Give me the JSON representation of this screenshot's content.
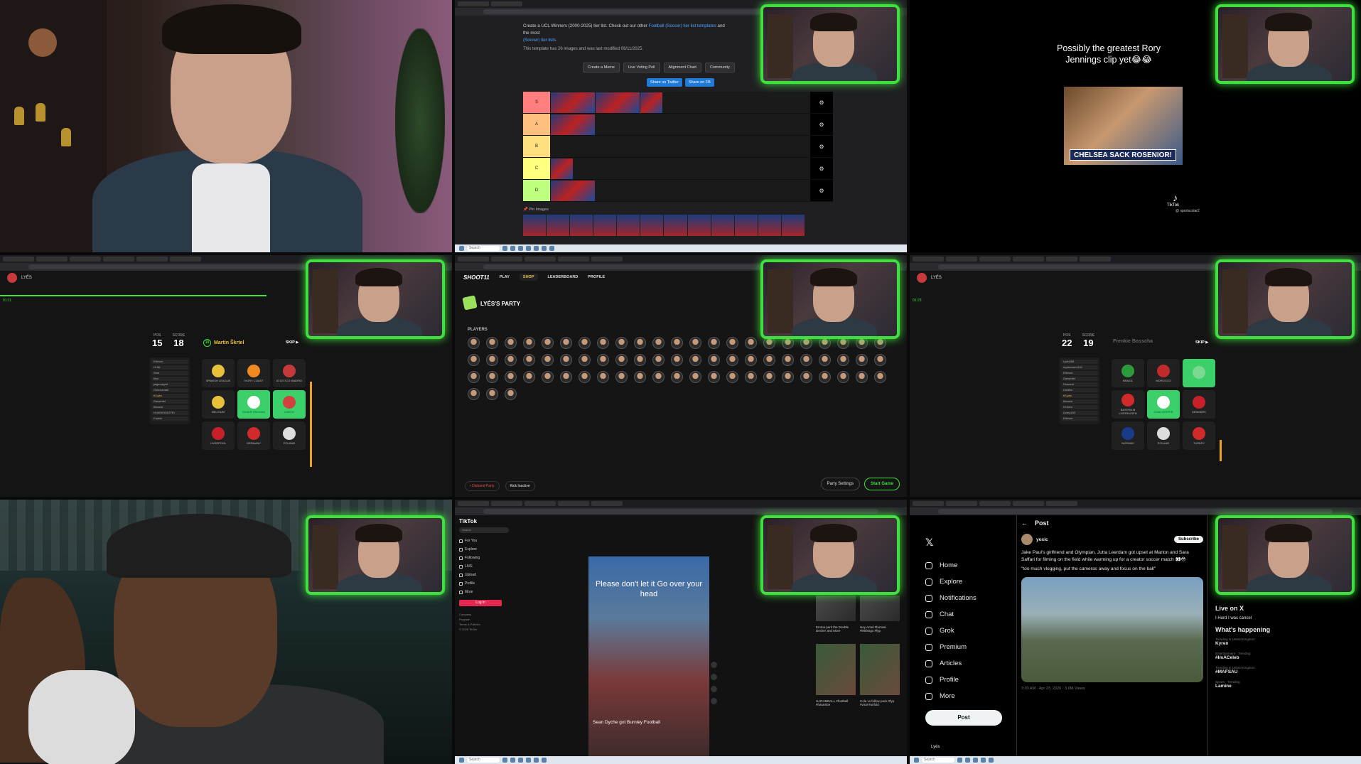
{
  "tier_list": {
    "intro_prefix": "Create a UCL Winners (2000-2025) tier list. Check out our other ",
    "intro_link": "Football (Soccer) tier list templates",
    "intro_suffix": " and the most",
    "intro_link2": "(Soccer) tier lists.",
    "meta": "This template has 26 images and was last modified 06/11/2025.",
    "buttons": [
      "Create a Meme",
      "Live Voting Poll",
      "Alignment Chart",
      "Community"
    ],
    "share": [
      "Share on Twitter",
      "Share on FB"
    ],
    "tiers": [
      {
        "label": "S",
        "color": "#ff7f7f"
      },
      {
        "label": "A",
        "color": "#ffbf7f"
      },
      {
        "label": "B",
        "color": "#ffdf7f"
      },
      {
        "label": "C",
        "color": "#ffff7f"
      },
      {
        "label": "D",
        "color": "#bfff7f"
      }
    ],
    "pin_label": "Pin Images"
  },
  "tiktok_clip": {
    "caption": "Possibly the greatest Rory Jennings clip yet😂😂",
    "banner": "CHELSEA SACK ROSENIOR!",
    "brand": "TikTok",
    "user": "@ sportscolar2"
  },
  "game_left": {
    "user": "LYÉS",
    "timer": "01:11",
    "pos_label": "POS",
    "pos_value": "15",
    "score_label": "SCORE",
    "score_value": "18",
    "player_number": "10",
    "player_name": "Martin Škrtel",
    "skip": "SKIP ▶",
    "board": [
      "Etienne",
      "Hi Mt",
      "Sme",
      "Ben",
      "jaigerragmt",
      "Ooreruinate",
      "K'Lyés",
      "Dansedel",
      "Bsmuw",
      "Hi AMICKNOTEI",
      "Fudolo"
    ],
    "board_me_index": 6,
    "cards": [
      {
        "label": "SPANISH LEAGUE",
        "flag": "#e8c13a",
        "green": false
      },
      {
        "label": "IVORY COAST",
        "flag": "#f08a20",
        "green": false
      },
      {
        "label": "ATLETICO MADRID",
        "flag": "#c23a3a",
        "green": false
      },
      {
        "label": "BELGIUM",
        "flag": "#e8c13a",
        "green": false
      },
      {
        "label": "DIDIER DROGBA",
        "flag": "#ffffff",
        "green": true
      },
      {
        "label": "CZECH",
        "flag": "#d04040",
        "green": true
      },
      {
        "label": "LIVERPOOL",
        "flag": "#c8202a",
        "green": false
      },
      {
        "label": "GERMANY",
        "flag": "#d02a2a",
        "green": false
      },
      {
        "label": "POLAND",
        "flag": "#dddddd",
        "green": false
      }
    ]
  },
  "party": {
    "logo": "SHOOT11",
    "nav": [
      "PLAY",
      "SHOP",
      "LEADERBOARD",
      "PROFILE"
    ],
    "active_index": 1,
    "title": "LYÉS'S PARTY",
    "players_label": "PLAYERS",
    "player_count": 72,
    "disband": "• Disband Party",
    "kick": "Kick Inactive",
    "settings": "Party Settings",
    "start": "Start Game"
  },
  "game_right": {
    "user": "LYÉS",
    "timer": "01:23",
    "pos_label": "POS",
    "pos_value": "22",
    "score_label": "SCORE",
    "score_value": "19",
    "player_name": "Frenkie Bosscha",
    "skip": "SKIP ▶",
    "board": [
      "Lyeh888",
      "mysteman1101",
      "Etienne",
      "Dansedel",
      "Dsmand",
      "Ltshitla",
      "K'Lyés",
      "Bsmuw",
      "Hi Aero",
      "Dzmy100",
      "Etienne"
    ],
    "board_me_index": 6,
    "cards": [
      {
        "label": "BRAZIL",
        "flag": "#2a9a3a",
        "green": false
      },
      {
        "label": "MOROCCO",
        "flag": "#c02a2a",
        "green": false
      },
      {
        "label": "",
        "flag": "#7ad890",
        "green": true
      },
      {
        "label": "BAYERN M LIVERKUSEN",
        "flag": "#d02a2a",
        "green": false
      },
      {
        "label": "GOALKEEPER",
        "flag": "#ffffff",
        "green": true
      },
      {
        "label": "DENMARK",
        "flag": "#c8202a",
        "green": false
      },
      {
        "label": "NORWAY",
        "flag": "#1a3a8a",
        "green": false
      },
      {
        "label": "POLAND",
        "flag": "#dddddd",
        "green": false
      },
      {
        "label": "TURKEY",
        "flag": "#d02a2a",
        "green": false
      }
    ]
  },
  "tiktok_web": {
    "logo": "TikTok",
    "search": "Search",
    "nav": [
      "For You",
      "Explore",
      "Following",
      "LIVE",
      "Upload",
      "Profile",
      "More"
    ],
    "login": "Log in",
    "footer": [
      "Company",
      "Program",
      "Terms & Policies",
      "© 2025 TikTok"
    ],
    "caption": "Please don't let it Go over your head",
    "desc": "Sean Dyche got Burnley Football",
    "thumbs": [
      "Emma park the Double Decker and More",
      "Hey Arnel #bonsai #letthisgo #fyp",
      "HARAMBALL #football #harambe",
      "Cole vs follow pack #fyp #viral #unfold"
    ]
  },
  "x": {
    "nav": [
      "Home",
      "Explore",
      "Notifications",
      "Chat",
      "Grok",
      "Premium",
      "Articles",
      "Profile",
      "More"
    ],
    "post_button": "Post",
    "footer_user": "Lyés",
    "header": "Post",
    "author": "yoxic",
    "subscribe": "Subscribe",
    "text": "Jake Paul's girlfriend and Olympian, Jutta Leerdam got upset at Marlon and Sara Saffari for filming on the field while warming up for a creator soccer match 👀😳",
    "quote": "\"too much vlogging, put the cameras away and focus on the ball\"",
    "views": "3:03 AM · Apr 23, 2026 · 3.6M Views",
    "live_title": "Live on X",
    "live_item": "I Hurd I was cancel",
    "happening": "What's happening",
    "trends": [
      {
        "c": "Trending in United Kingdom",
        "t": "Kyren"
      },
      {
        "c": "Entertainment · Trending",
        "t": "#ImACeleb"
      },
      {
        "c": "Trending in United Kingdom",
        "t": "#MAFSAU"
      },
      {
        "c": "Sports · Trending",
        "t": "Lamine"
      }
    ]
  }
}
